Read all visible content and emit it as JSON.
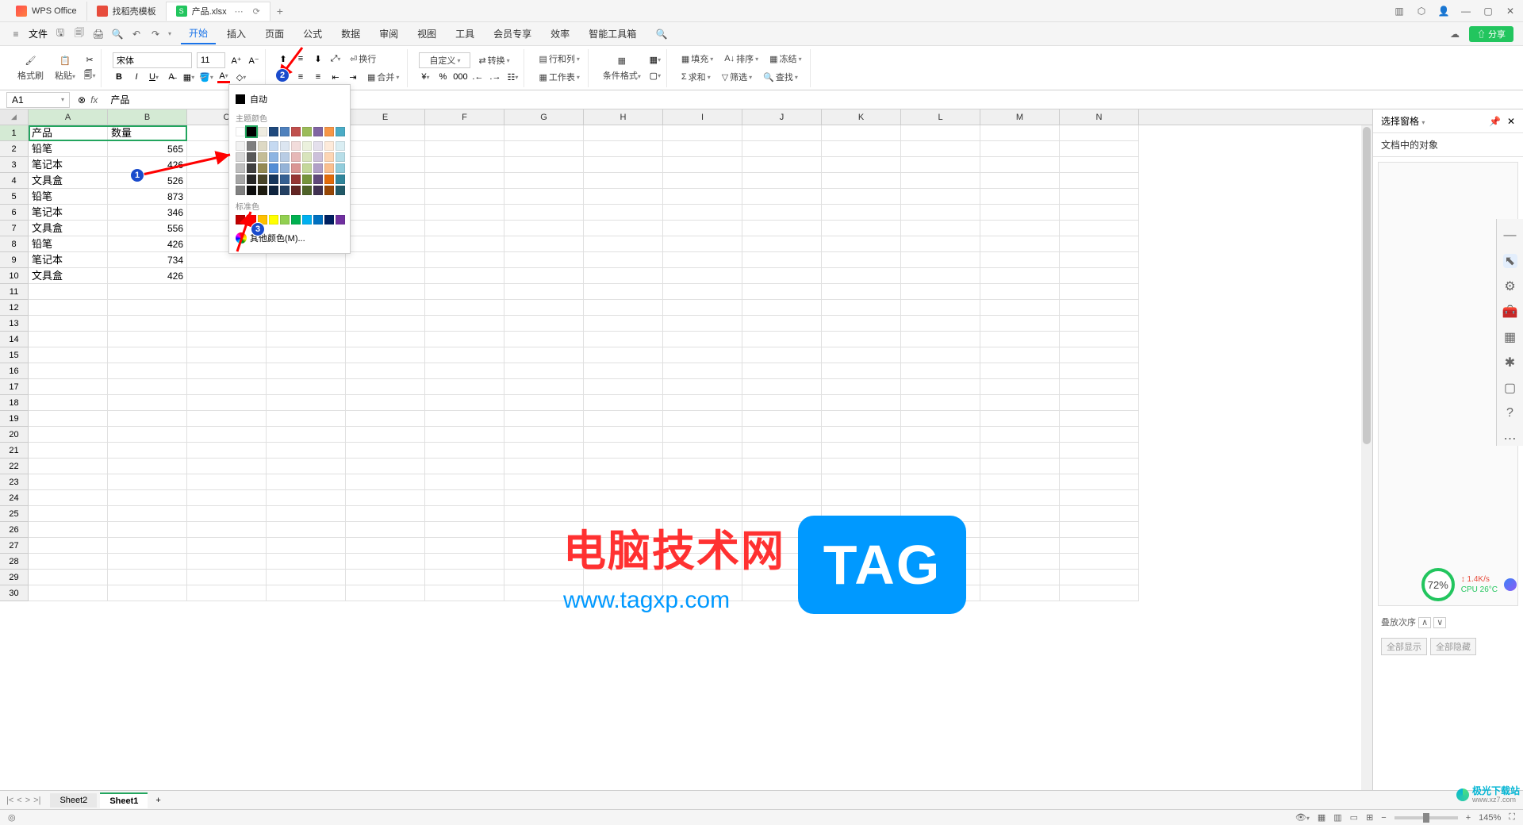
{
  "titlebar": {
    "tabs": [
      {
        "icon": "wps",
        "label": "WPS Office"
      },
      {
        "icon": "shell",
        "label": "找稻壳模板"
      },
      {
        "icon": "xlsx",
        "label": "产品.xlsx"
      }
    ],
    "add": "+"
  },
  "menubar": {
    "file": "文件",
    "items": [
      "开始",
      "插入",
      "页面",
      "公式",
      "数据",
      "审阅",
      "视图",
      "工具",
      "会员专享",
      "效率",
      "智能工具箱"
    ],
    "active": 0,
    "share": "分享"
  },
  "ribbon": {
    "format_painter": "格式刷",
    "paste": "粘贴",
    "font": "宋体",
    "font_size": "11",
    "wrap": "换行",
    "custom": "自定义",
    "convert": "转换",
    "rowcol": "行和列",
    "worksheet": "工作表",
    "cond_format": "条件格式",
    "merge": "合并",
    "fill": "填充",
    "sort": "排序",
    "freeze": "冻结",
    "sum": "求和",
    "filter": "筛选",
    "find": "查找"
  },
  "formula_bar": {
    "name_box": "A1",
    "fx": "fx",
    "value": "产品"
  },
  "columns": [
    "A",
    "B",
    "C",
    "D",
    "E",
    "F",
    "G",
    "H",
    "I",
    "J",
    "K",
    "L",
    "M",
    "N"
  ],
  "sheet_data": {
    "headers": [
      "产品",
      "数量"
    ],
    "rows": [
      [
        "铅笔",
        565
      ],
      [
        "笔记本",
        426
      ],
      [
        "文具盒",
        526
      ],
      [
        "铅笔",
        873
      ],
      [
        "笔记本",
        346
      ],
      [
        "文具盒",
        556
      ],
      [
        "铅笔",
        426
      ],
      [
        "笔记本",
        734
      ],
      [
        "文具盒",
        426
      ]
    ]
  },
  "row_numbers": [
    1,
    2,
    3,
    4,
    5,
    6,
    7,
    8,
    9,
    10,
    11,
    12,
    13,
    14,
    15,
    16,
    17,
    18,
    19,
    20,
    21,
    22,
    23,
    24,
    25,
    26,
    27,
    28,
    29,
    30
  ],
  "color_picker": {
    "auto": "自动",
    "theme_label": "主题颜色",
    "standard_label": "标准色",
    "more": "其他颜色(M)...",
    "theme_row1": [
      "#ffffff",
      "#000000",
      "#eeece1",
      "#1f497d",
      "#4f81bd",
      "#c0504d",
      "#9bbb59",
      "#8064a2",
      "#f79646",
      "#4bacc6"
    ],
    "theme_shades": [
      [
        "#f2f2f2",
        "#7f7f7f",
        "#ddd9c4",
        "#c5d9f1",
        "#dce6f1",
        "#f2dcdb",
        "#ebf1dd",
        "#e4dfec",
        "#fdeada",
        "#daeef3"
      ],
      [
        "#d9d9d9",
        "#595959",
        "#c4bd97",
        "#8db4e2",
        "#b8cce4",
        "#e6b8b7",
        "#d8e4bc",
        "#ccc0da",
        "#fcd5b4",
        "#b7dee8"
      ],
      [
        "#bfbfbf",
        "#404040",
        "#948a54",
        "#538dd5",
        "#95b3d7",
        "#da9694",
        "#c4d79b",
        "#b1a0c7",
        "#fabf8f",
        "#92cddc"
      ],
      [
        "#a6a6a6",
        "#262626",
        "#494529",
        "#16365c",
        "#366092",
        "#963634",
        "#76933c",
        "#60497a",
        "#e26b0a",
        "#31869b"
      ],
      [
        "#808080",
        "#0d0d0d",
        "#1d1b10",
        "#0f243e",
        "#244062",
        "#632523",
        "#4f6228",
        "#403151",
        "#974706",
        "#215967"
      ]
    ],
    "standard": [
      "#c00000",
      "#ff0000",
      "#ffc000",
      "#ffff00",
      "#92d050",
      "#00b050",
      "#00b0f0",
      "#0070c0",
      "#002060",
      "#7030a0"
    ],
    "selected_theme": 1
  },
  "side_panel": {
    "title": "选择窗格",
    "sub": "文档中的对象",
    "stack": "叠放次序",
    "show_all": "全部显示",
    "hide_all": "全部隐藏"
  },
  "sheet_tabs": {
    "tabs": [
      "Sheet2",
      "Sheet1"
    ],
    "active": 1
  },
  "status": {
    "left": "◎",
    "zoom": "145%"
  },
  "annotations": {
    "badge1": "1",
    "badge2": "2",
    "badge3": "3"
  },
  "watermark": {
    "main": "电脑技术网",
    "url": "www.tagxp.com",
    "tag": "TAG",
    "cpu_pct": "72%",
    "net": "1.4K/s",
    "cpu_temp": "CPU 26°C",
    "site": "极光下载站",
    "site_url": "www.xz7.com"
  }
}
